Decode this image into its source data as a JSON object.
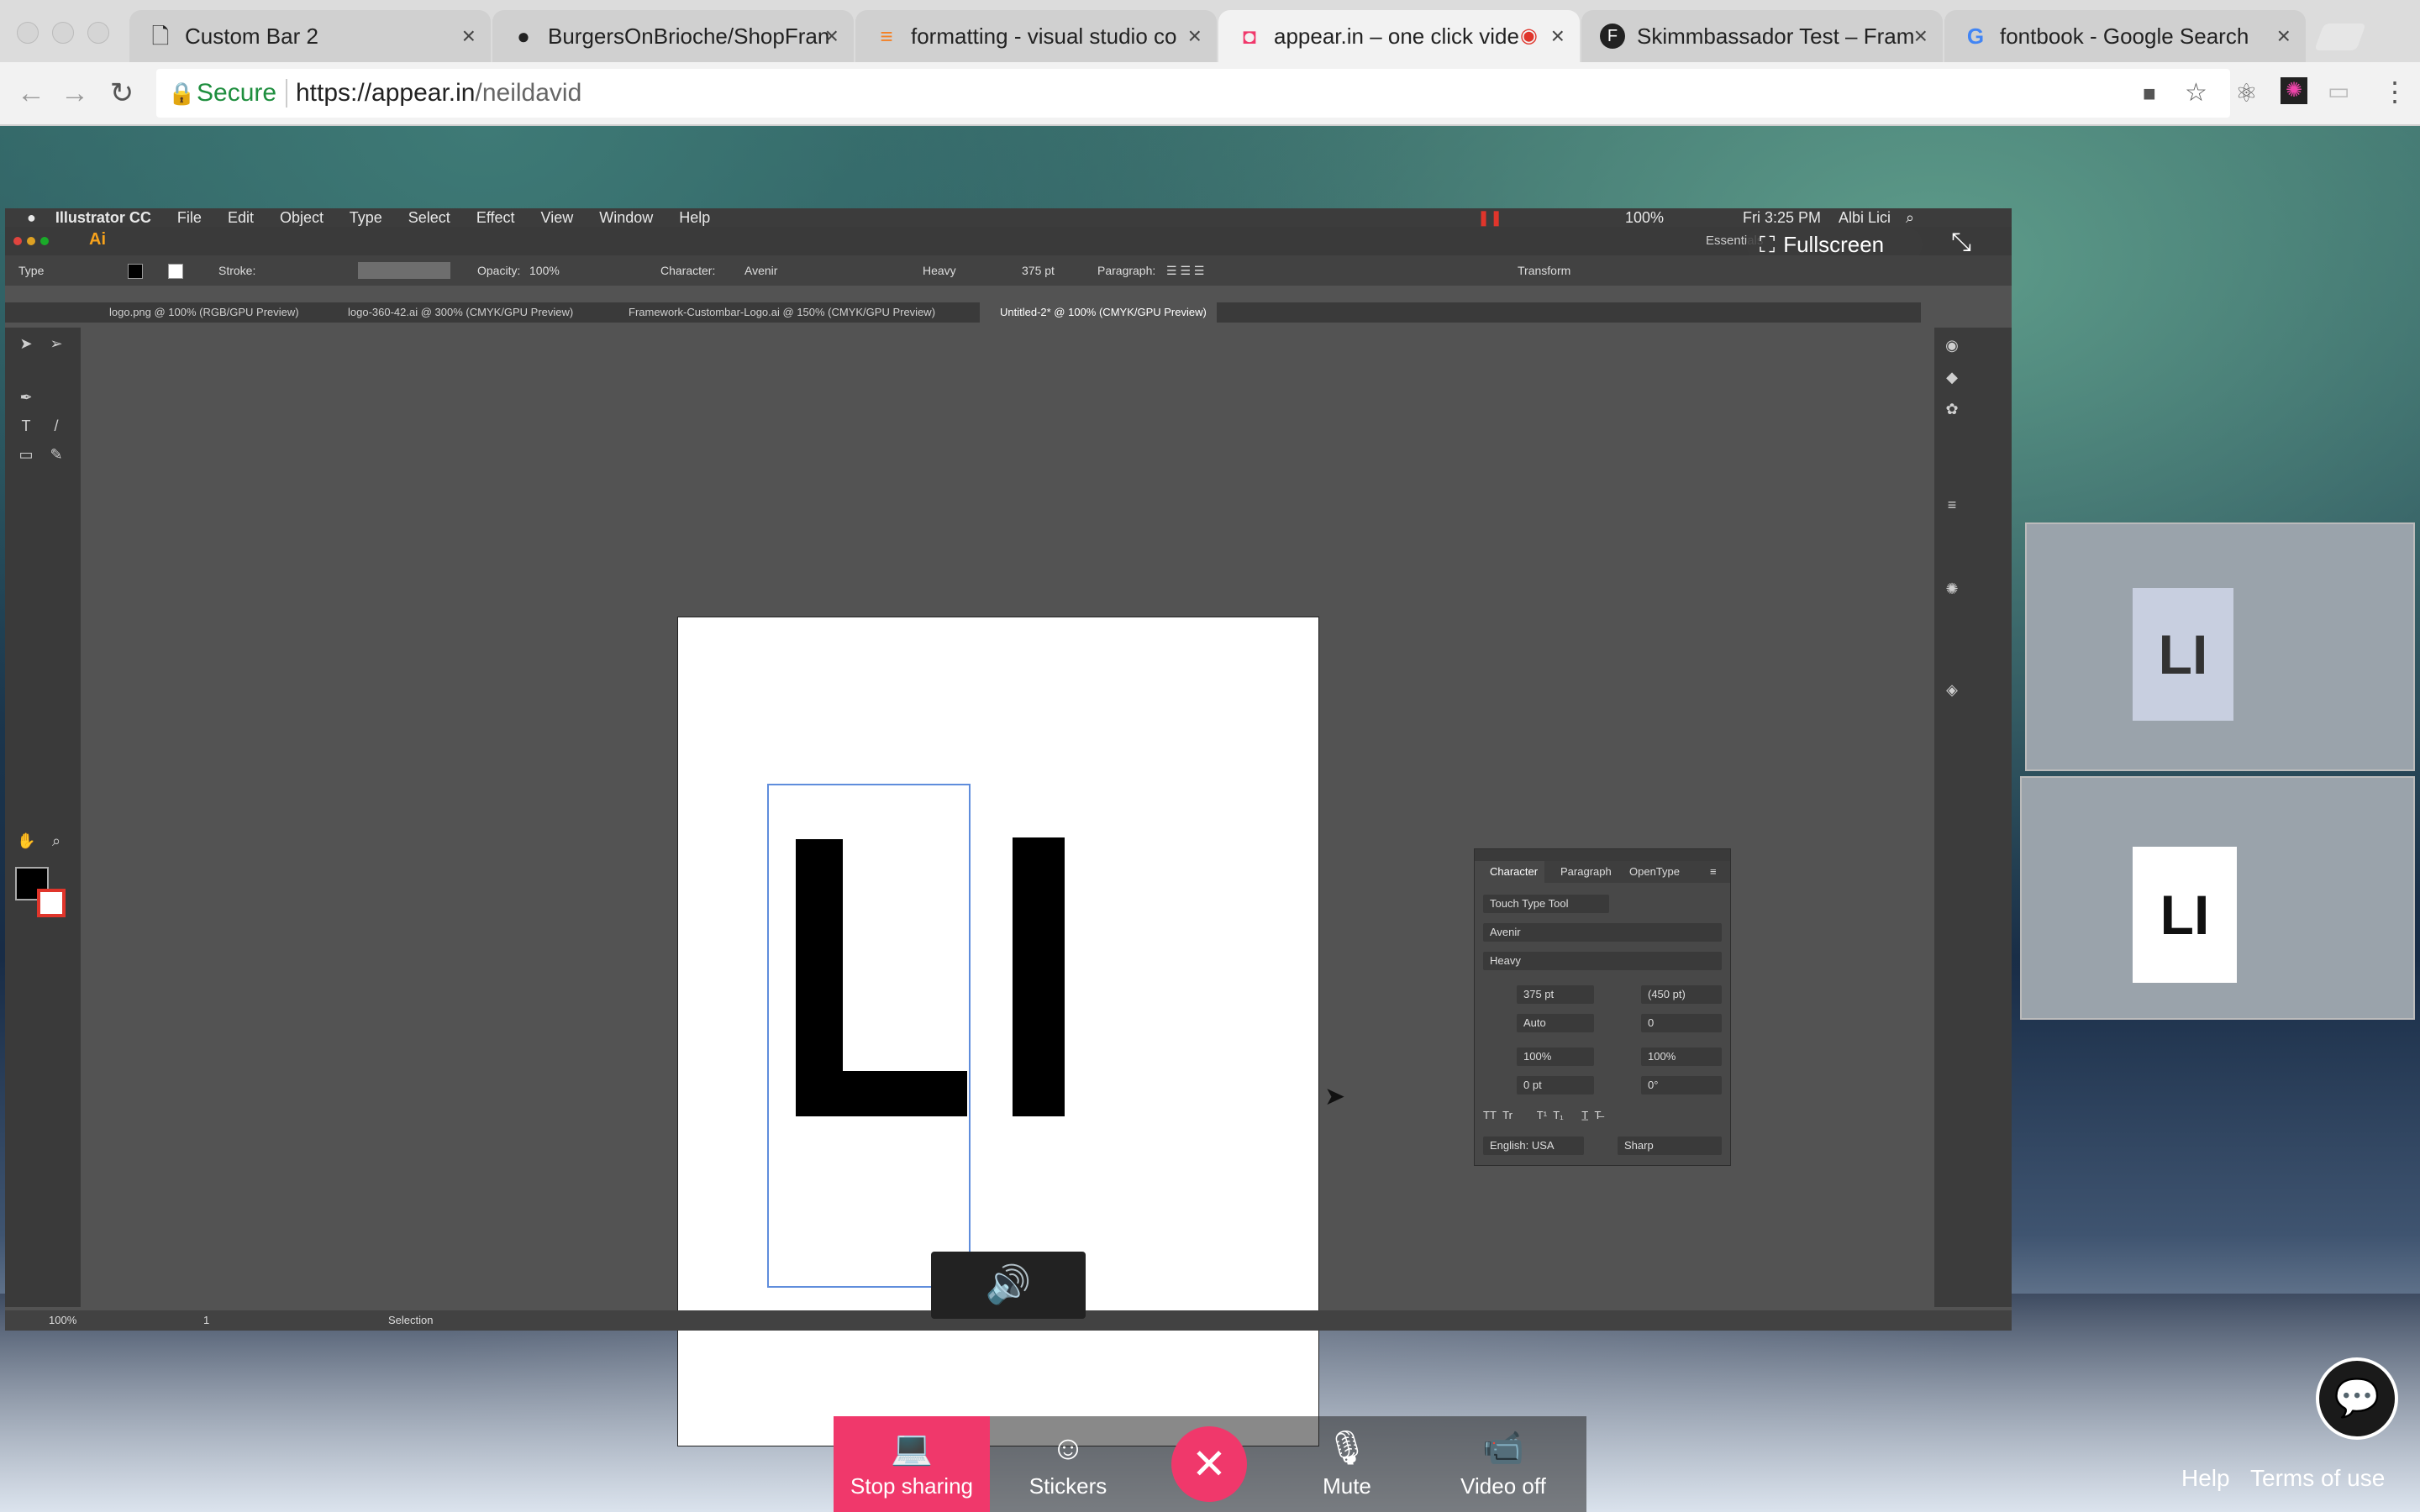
{
  "browser": {
    "tabs": [
      {
        "title": "Custom Bar 2",
        "icon": "document-icon"
      },
      {
        "title": "BurgersOnBrioche/ShopFran",
        "icon": "github-icon"
      },
      {
        "title": "formatting - visual studio co",
        "icon": "stackoverflow-icon"
      },
      {
        "title": "appear.in – one click vide",
        "icon": "appear-in-icon"
      },
      {
        "title": "Skimmbassador Test – Fram",
        "icon": "framer-icon"
      },
      {
        "title": "fontbook - Google Search",
        "icon": "google-icon"
      }
    ],
    "active_tab": 3,
    "secure_label": "Secure",
    "url_host": "https://appear.in",
    "url_path": "/neildavid"
  },
  "illustrator": {
    "menu": {
      "app": "Illustrator CC",
      "items": [
        "File",
        "Edit",
        "Object",
        "Type",
        "Select",
        "Effect",
        "View",
        "Window",
        "Help"
      ],
      "battery": "100%",
      "clock": "Fri 3:25 PM",
      "user": "Albi Lici"
    },
    "app_logo": "Ai",
    "workspace": "Essentials",
    "fullscreen_label": "Fullscreen",
    "control": {
      "type": "Type",
      "stroke": "Stroke:",
      "opacity_label": "Opacity:",
      "opacity": "100%",
      "character": "Character:",
      "font": "Avenir",
      "weight": "Heavy",
      "size": "375 pt",
      "paragraph": "Paragraph:",
      "transform": "Transform"
    },
    "doc_tabs": [
      "logo.png @ 100% (RGB/GPU Preview)",
      "logo-360-42.ai @ 300% (CMYK/GPU Preview)",
      "Framework-Custombar-Logo.ai @ 150% (CMYK/GPU Preview)",
      "Untitled-2* @ 100% (CMYK/GPU Preview)"
    ],
    "active_doc": 3,
    "artboard_text": "LI",
    "status": {
      "zoom": "100%",
      "page": "1",
      "tool": "Selection"
    },
    "character_panel": {
      "tabs": [
        "Character",
        "Paragraph",
        "OpenType"
      ],
      "touch_tool": "Touch Type Tool",
      "font": "Avenir",
      "style": "Heavy",
      "size": "375 pt",
      "leading": "(450 pt)",
      "kerning": "Auto",
      "tracking": "0",
      "vscale": "100%",
      "hscale": "100%",
      "baseline": "0 pt",
      "rotation": "0°",
      "language": "English: USA",
      "aa": "Sharp"
    }
  },
  "thumb_text": [
    "LI",
    "LI"
  ],
  "call_controls": {
    "stop_sharing": "Stop sharing",
    "stickers": "Stickers",
    "mute": "Mute",
    "video_off": "Video off"
  },
  "footer_links": [
    "Help",
    "Terms of use"
  ],
  "colors": {
    "accent": "#f0386b",
    "end_call": "#f0386b",
    "secure_green": "#1e8e3e"
  }
}
